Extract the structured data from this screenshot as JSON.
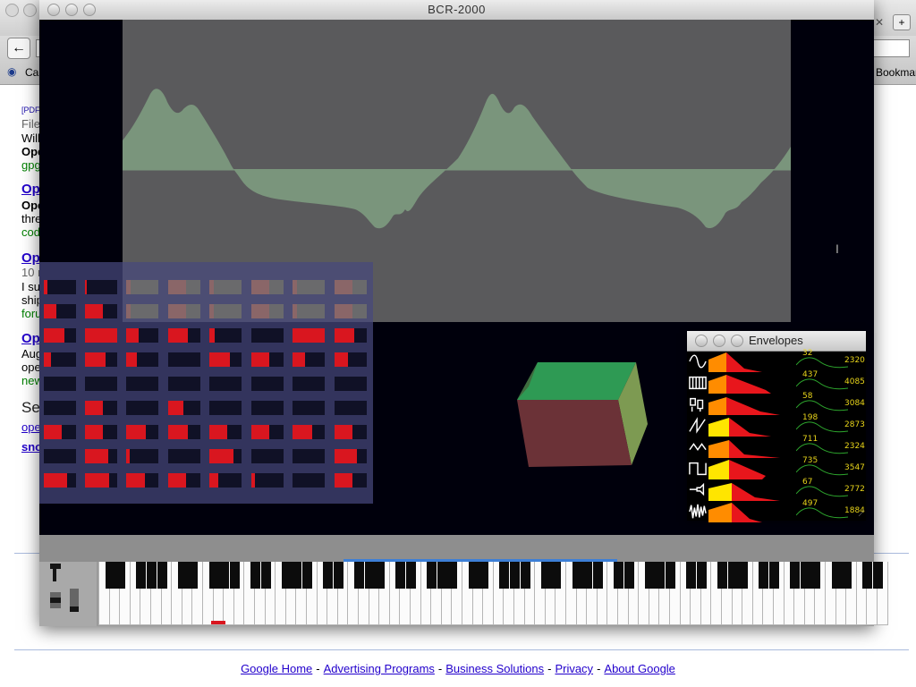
{
  "window": {
    "title": "BCR-2000"
  },
  "browser": {
    "back_glyph": "←",
    "bookmark_label": "Ca",
    "bookmark_right": "Bookmar",
    "results": {
      "r1_tag": "[PDF]",
      "r1_line1": "File",
      "r1_line2": "Will",
      "r1_line3": "Ope",
      "r1_url": "gpg",
      "r2_title": "Op",
      "r2_line1": "Ope",
      "r2_line2": "thre",
      "r2_url": "cod",
      "r3_title": "Op",
      "r3_line1": "10 r",
      "r3_line2": "I su",
      "r3_line3": "ship",
      "r3_url": "foru",
      "r4_title": "Op",
      "r4_line1": "Aug",
      "r4_line2": "ope",
      "r4_url": "new",
      "se_heading": "Se",
      "se_link1": "ope",
      "se_link2": "sno"
    }
  },
  "footer": {
    "links": [
      "Google Home",
      "Advertising Programs",
      "Business Solutions",
      "Privacy",
      "About Google"
    ],
    "separator": "-"
  },
  "grid": {
    "rows": [
      [
        0.12,
        0.06,
        0.0,
        0.0,
        0.0,
        0.0,
        0.0,
        0.0
      ],
      [
        0.4,
        0.55,
        0.0,
        0.0,
        0.0,
        0.0,
        0.0,
        0.0
      ],
      [
        0.65,
        1.0,
        0.38,
        0.6,
        0.18,
        0.0,
        1.0,
        0.62
      ],
      [
        0.22,
        0.65,
        0.32,
        0.0,
        0.65,
        0.55,
        0.4,
        0.42
      ],
      [
        0.0,
        0.0,
        0.0,
        0.0,
        0.0,
        0.0,
        0.0,
        0.0
      ],
      [
        0.0,
        0.55,
        0.0,
        0.48,
        0.0,
        0.0,
        0.0,
        0.0
      ],
      [
        0.55,
        0.55,
        0.6,
        0.6,
        0.55,
        0.55,
        0.6,
        0.55
      ],
      [
        0.0,
        0.72,
        0.1,
        0.0,
        0.75,
        0.0,
        0.0,
        0.7
      ],
      [
        0.72,
        0.75,
        0.58,
        0.55,
        0.28,
        0.1,
        0.0,
        0.55
      ]
    ],
    "faded_rows": 2,
    "faded_cols_from": 2
  },
  "envelopes": {
    "title": "Envelopes",
    "rows": [
      {
        "icon": "sine-wave-icon",
        "attack_color": "#ff8c00",
        "v1": "32",
        "v2": "2320"
      },
      {
        "icon": "piano-keys-icon",
        "attack_color": "#ff8c00",
        "v1": "437",
        "v2": "4085"
      },
      {
        "icon": "drum-kit-icon",
        "attack_color": "#ff8c00",
        "v1": "58",
        "v2": "3084"
      },
      {
        "icon": "sawtooth-wave-icon",
        "attack_color": "#ffe500",
        "v1": "198",
        "v2": "2873"
      },
      {
        "icon": "triangle-wave-icon",
        "attack_color": "#ff8c00",
        "v1": "711",
        "v2": "2324"
      },
      {
        "icon": "square-wave-icon",
        "attack_color": "#ffe500",
        "v1": "735",
        "v2": "3547"
      },
      {
        "icon": "trumpet-icon",
        "attack_color": "#ffe500",
        "v1": "67",
        "v2": "2772"
      },
      {
        "icon": "noise-wave-icon",
        "attack_color": "#ff8c00",
        "v1": "497",
        "v2": "1884"
      }
    ]
  },
  "colors": {
    "wave_fill": "#7a957c",
    "cell_on": "#d9161f",
    "cell_off": "#101126",
    "value_text": "#e8d41a",
    "keyboard_highlight": "#3d7fd6"
  },
  "keyboard": {
    "white_keys": 76,
    "marked_note_index": 11
  }
}
